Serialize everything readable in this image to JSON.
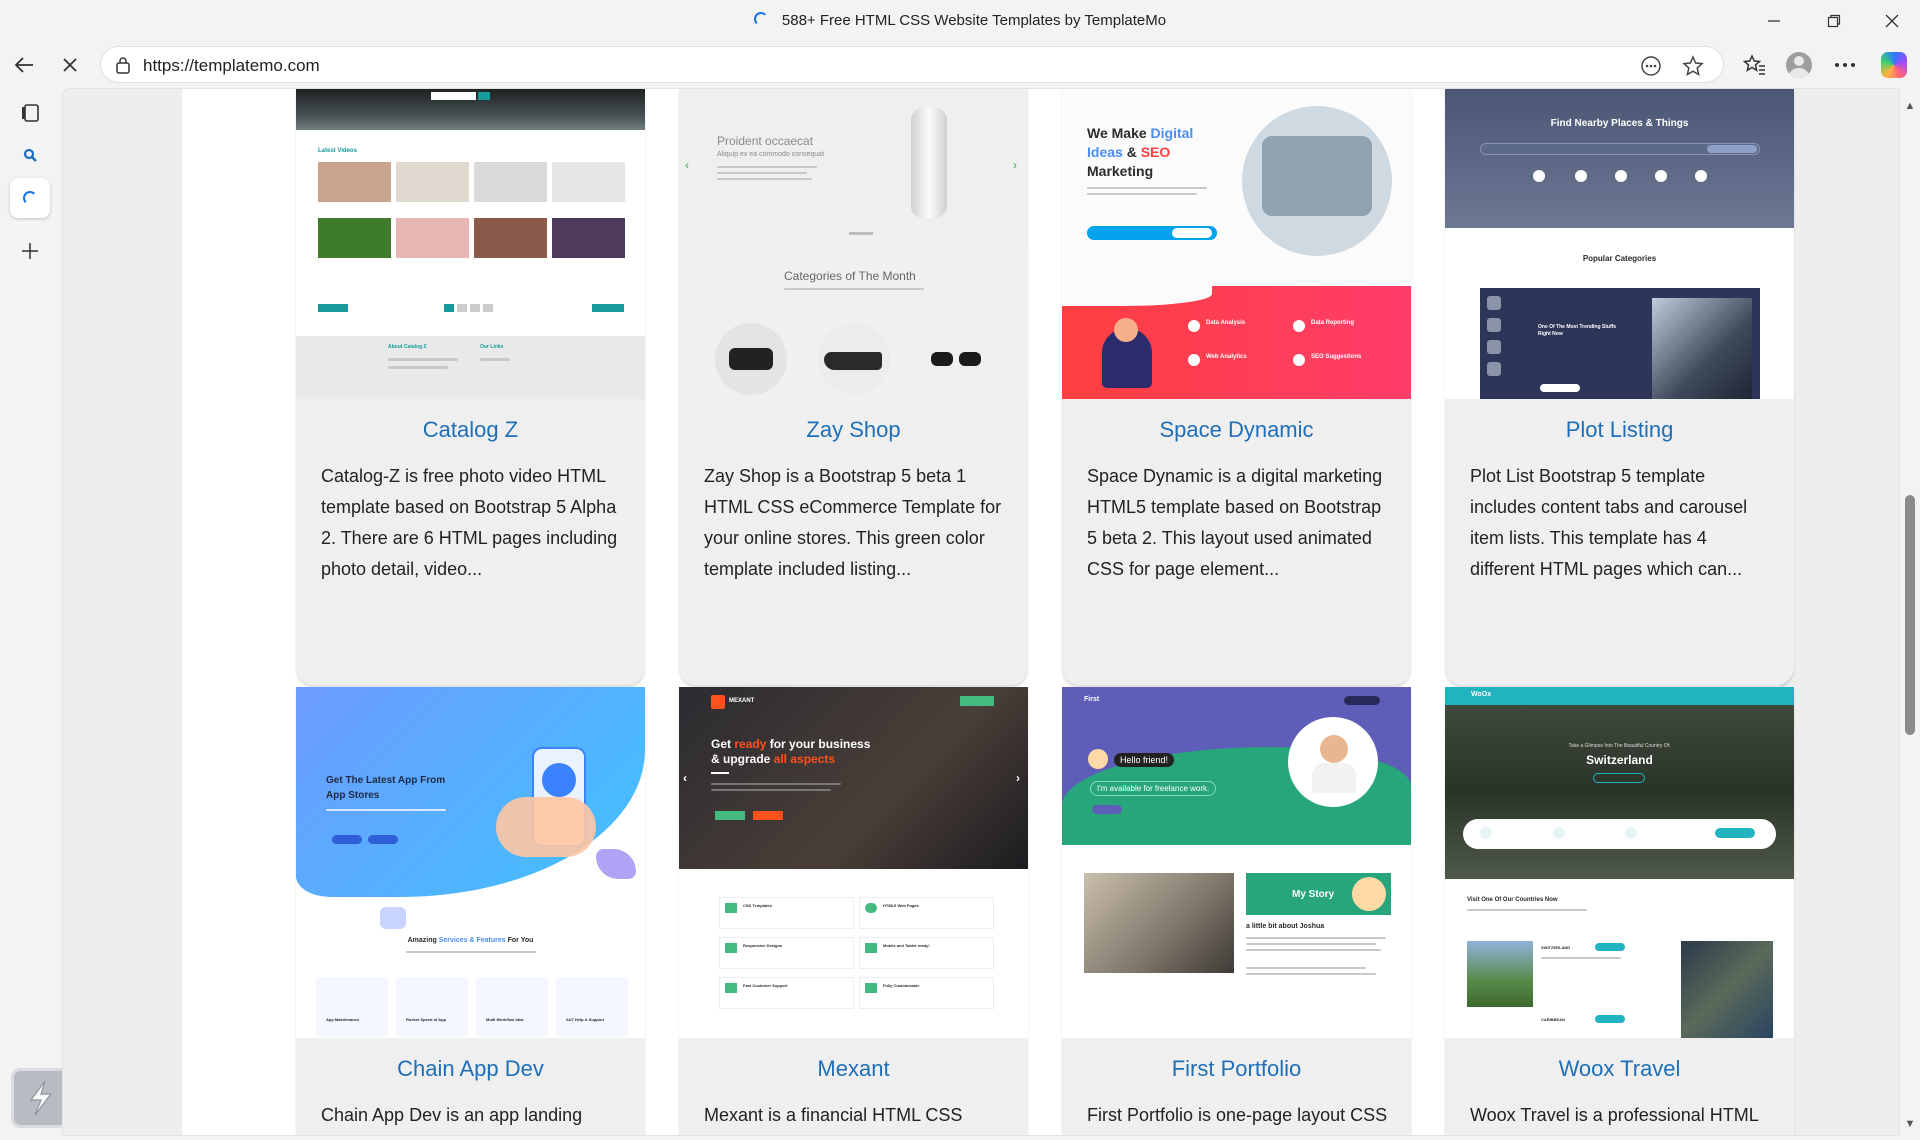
{
  "window": {
    "title": "588+ Free HTML CSS Website Templates by TemplateMo",
    "minimize_icon": "minimize-icon",
    "restore_icon": "restore-icon",
    "close_icon": "close-icon"
  },
  "addressbar": {
    "url": "https://templatemo.com"
  },
  "sidebar": {
    "items": [
      "tabs-icon",
      "search-icon",
      "templatemo-tab-icon",
      "add-icon"
    ]
  },
  "cards": [
    {
      "title": "Catalog Z",
      "description": "Catalog-Z is free photo video HTML template based on Bootstrap 5 Alpha 2. There are 6 HTML pages including photo detail, video...",
      "thumb": {
        "section": "Latest Videos",
        "about": "About Catalog Z",
        "links": "Our Links"
      }
    },
    {
      "title": "Zay Shop",
      "description": "Zay Shop is a Bootstrap 5 beta 1 HTML CSS eCommerce Template for your online stores. This green color template included listing...",
      "thumb": {
        "heading": "Proident occaecat",
        "sub": "Aliquip ex ea commodo consequat",
        "section": "Categories of The Month"
      }
    },
    {
      "title": "Space Dynamic",
      "description": "Space Dynamic is a digital marketing HTML5 template based on Bootstrap 5 beta 2. This layout used animated CSS for page element...",
      "thumb": {
        "line1a": "We Make ",
        "line1b": "Digital",
        "line2a": "Ideas",
        "line2b": " & ",
        "line2c": "SEO",
        "line3": "Marketing",
        "services": [
          "Data Analysis",
          "Data Reporting",
          "Web Analytics",
          "SEO Suggestions"
        ]
      }
    },
    {
      "title": "Plot Listing",
      "description": "Plot List Bootstrap 5 template includes content tabs and carousel item lists. This template has 4 different HTML pages which can...",
      "thumb": {
        "hero": "Find Nearby Places & Things",
        "section": "Popular Categories",
        "feature": "One Of The Most Trending Stuffs Right Now"
      }
    },
    {
      "title": "Chain App Dev",
      "description": "Chain App Dev is an app landing page",
      "thumb": {
        "hero": "Get The Latest App From App Stores",
        "sectiona": "Amazing ",
        "sectionb": "Services & Features",
        "sectionc": " For You",
        "features": [
          "App Maintenance",
          "Rocket Speed of App",
          "Multi Workflow Idea",
          "24/7 Help & Support"
        ]
      }
    },
    {
      "title": "Mexant",
      "description": "Mexant is a financial HTML CSS",
      "thumb": {
        "brand": "MEXANT",
        "hero1a": "Get ",
        "hero1b": "ready",
        "hero1c": " for your business",
        "hero2a": "& upgrade ",
        "hero2b": "all aspects",
        "items": [
          "CSS Templates",
          "HTML5 Web Pages",
          "Responsive Designs",
          "Mobile and Tablet ready!",
          "Fast Customer Support",
          "Fully Customizable"
        ]
      }
    },
    {
      "title": "First Portfolio",
      "description": "First Portfolio is one-page layout CSS",
      "thumb": {
        "brand": "First",
        "bubble1": "Hello friend!",
        "bubble2": "I'm available for freelance work.",
        "story": "My Story",
        "about": "a little bit about Joshua"
      }
    },
    {
      "title": "Woox Travel",
      "description": "Woox Travel is a professional HTML",
      "thumb": {
        "brand": "WoOx",
        "tag": "Take a Glimpse Into The Beautiful Country Of:",
        "country": "Switzerland",
        "section": "Visit One Of Our Countries Now",
        "places": [
          "SWITZERLAND",
          "CARIBBEAN"
        ]
      }
    }
  ]
}
